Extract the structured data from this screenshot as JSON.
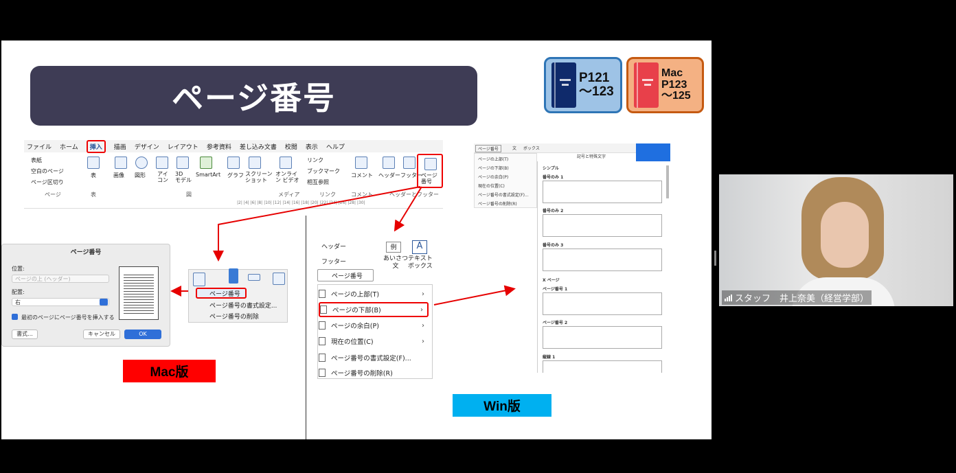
{
  "slide": {
    "title": "ページ番号",
    "book_win": {
      "line1": "P121",
      "line2": "～123",
      "color": "#0f2a6b"
    },
    "book_mac": {
      "line1": "Mac",
      "line2": "P123",
      "line3": "～125",
      "color": "#e8404a"
    },
    "ribbon": {
      "menu": [
        "ファイル",
        "ホーム",
        "挿入",
        "描画",
        "デザイン",
        "レイアウト",
        "参考資料",
        "差し込み文書",
        "校閲",
        "表示",
        "ヘルプ"
      ],
      "active_tab": "挿入",
      "pages_items": [
        "表紙",
        "空白のページ",
        "ページ区切り"
      ],
      "pages_group": "ページ",
      "table_label": "表",
      "table_group": "表",
      "illus": [
        "画像",
        "図形",
        "アイ\nコン",
        "3D\nモデル",
        "SmartArt",
        "グラフ",
        "スクリーン\nショット"
      ],
      "illus_group": "図",
      "online_video": "オンライ\nン ビデオ",
      "media_group": "メディア",
      "links": [
        "リンク",
        "ブックマーク",
        "相互参照"
      ],
      "links_group": "リンク",
      "comment": "コメント",
      "comment_group": "コメント",
      "header": "ヘッダー",
      "footer": "フッター",
      "page_number": "ページ\n番号",
      "hf_group": "ヘッダーとフッター",
      "ruler": "|2| |4| |6| |8| |10| |12| |14| |16| |18| |20| |22| |24| |26| |28| |30|"
    },
    "mac_dialog": {
      "title": "ページ番号",
      "position_label": "位置:",
      "position_value": "ページの上 (ヘッダー)",
      "align_label": "配置:",
      "align_value": "右",
      "checkbox_label": "最初のページにページ番号を挿入する",
      "format_button": "書式...",
      "cancel_button": "キャンセル",
      "ok_button": "OK"
    },
    "mac_menu": {
      "items": [
        "ページ番号",
        "ページ番号の書式設定...",
        "ページ番号の削除"
      ]
    },
    "mac_badge": "Mac版",
    "win_panel": {
      "header_btn": "ヘッダー",
      "footer_btn": "フッター",
      "page_number_btn": "ページ番号",
      "greeting": "あいさつ\n文",
      "greeting_icon": "例",
      "textbox": "テキスト\nボックス",
      "items": [
        "ページの上部(T)",
        "ページの下部(B)",
        "ページの余白(P)",
        "現在の位置(C)",
        "ページ番号の書式設定(F)...",
        "ページ番号の削除(R)"
      ]
    },
    "win_badge": "Win版",
    "gallery": {
      "toolbar_btn": "ページ番号",
      "toolbar_items": [
        "文",
        "ボックス",
        "記号と特殊文字"
      ],
      "menu_items": [
        "ページの上部(T)",
        "ページの下部(B)",
        "ページの余白(P)",
        "現在の位置(C)",
        "ページ番号の書式設定(F)...",
        "ページ番号の削除(R)"
      ],
      "section_simple": "シンプル",
      "entries": [
        "番号のみ 1",
        "番号のみ 2",
        "番号のみ 3",
        "ページ番号 1",
        "ページ番号 2",
        "縦線 1"
      ],
      "section_x": "X ページ"
    }
  },
  "camera": {
    "name": "スタッフ　井上奈美（経営学部）"
  },
  "colors": {
    "title_bg": "#3e3c55",
    "accent_red": "#e60000",
    "mac_badge_bg": "#ff0000",
    "win_badge_bg": "#00b0f0",
    "word_blue": "#2b579a"
  }
}
